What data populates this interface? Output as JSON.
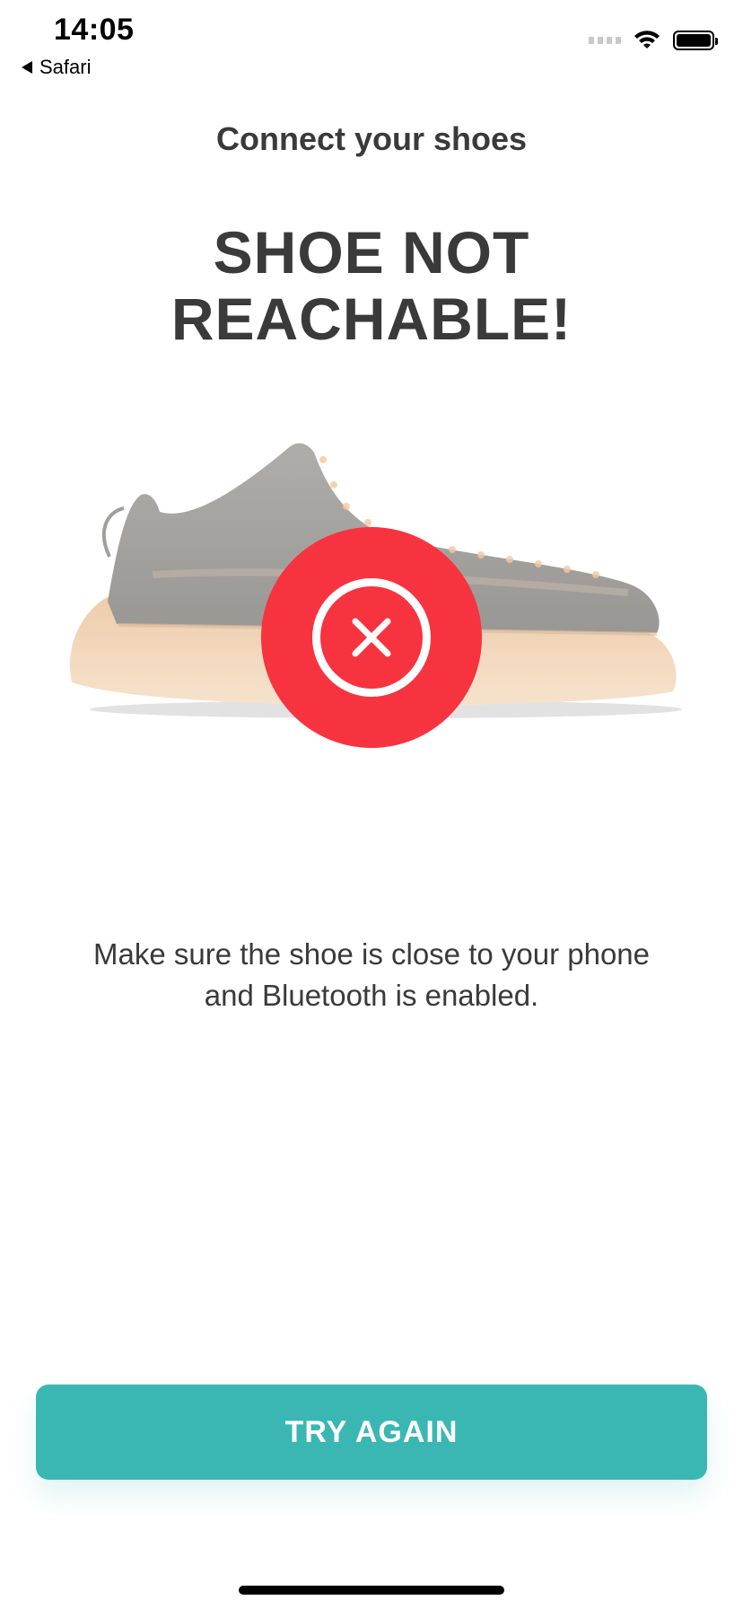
{
  "status_bar": {
    "time": "14:05",
    "back_label": "Safari"
  },
  "header": {
    "subtitle": "Connect your shoes",
    "headline_line1": "SHOE NOT",
    "headline_line2": "REACHABLE!"
  },
  "message": {
    "line1": "Make sure the shoe is close to your phone",
    "line2": "and Bluetooth is enabled."
  },
  "actions": {
    "try_again_label": "TRY AGAIN"
  },
  "colors": {
    "accent": "#3ab7b3",
    "error": "#f7333f",
    "text": "#3a3a3a"
  },
  "icons": {
    "back": "back-triangle-icon",
    "wifi": "wifi-icon",
    "signal": "signal-icon",
    "battery": "battery-icon",
    "error": "close-circle-icon"
  }
}
